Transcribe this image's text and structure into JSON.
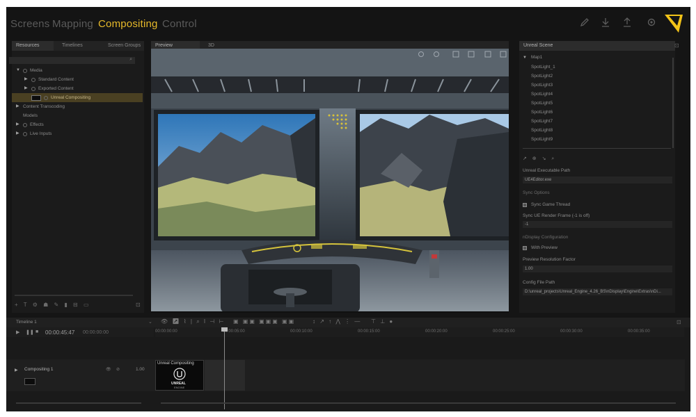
{
  "topbar": {
    "nav": [
      "Screens",
      "Mapping",
      "Compositing",
      "Control"
    ],
    "active_index": 2,
    "accent": "#e6b92a",
    "icons": [
      "edit-icon",
      "download-icon",
      "upload-icon",
      "gear-icon"
    ]
  },
  "resources_panel": {
    "tabs": [
      "Resources",
      "Timelines",
      "Screen Groups"
    ],
    "tree": [
      {
        "label": "Media",
        "level": 0,
        "arrow": "▼",
        "circle": true
      },
      {
        "label": "Standard Content",
        "level": 1,
        "arrow": "▶",
        "circle": true
      },
      {
        "label": "Exported Content",
        "level": 1,
        "arrow": "▶",
        "circle": true
      },
      {
        "label": "Unreal Compositing",
        "level": 1,
        "arrow": "",
        "circle": true,
        "selected": true
      },
      {
        "label": "Content Transcoding",
        "level": 0,
        "arrow": "▶",
        "circle": false
      },
      {
        "label": "Models",
        "level": 0,
        "arrow": "",
        "circle": false
      },
      {
        "label": "Effects",
        "level": 0,
        "arrow": "▶",
        "circle": true
      },
      {
        "label": "Live Inputs",
        "level": 0,
        "arrow": "▶",
        "circle": true
      }
    ]
  },
  "preview_panel": {
    "tabs": [
      "Preview",
      "3D"
    ]
  },
  "unreal_panel": {
    "title": "Unreal Scene",
    "root": "Map1",
    "spotlights": [
      "SpotLight_1",
      "SpotLight2",
      "SpotLight3",
      "SpotLight4",
      "SpotLight5",
      "SpotLight6",
      "SpotLight7",
      "SpotLight8",
      "SpotLight9"
    ],
    "exec_path_label": "Unreal Executable Path",
    "exec_path_value": "UE4Editor.exe",
    "sync_options_label": "Sync Options",
    "sync_game_thread_label": "Sync Game Thread",
    "sync_ue_render_label": "Sync UE Render Frame (-1 is off)",
    "sync_ue_render_value": "-1",
    "ndisplay_label": "nDisplay Configuration",
    "with_preview_label": "With Preview",
    "preview_res_label": "Preview Resolution Factor",
    "preview_res_value": "1.00",
    "config_path_label": "Config File Path",
    "config_path_value": "D:\\unreal_projects\\Unreal_Engine_4.26_BS\\nDisplay\\Engine\\Extras\\nDi..."
  },
  "timeline": {
    "title": "Timeline 1",
    "timecode": "00:00:45:47",
    "timecode2": "00:00:00:00",
    "ticks": [
      "00:00:00:00",
      "00:00:05:00",
      "00:00:10:00",
      "00:00:15:00",
      "00:00:20:00",
      "00:00:25:00",
      "00:00:30:00",
      "00:00:35:00",
      "00:00:40:00"
    ],
    "track_name": "Compositing 1",
    "track_value": "1.00",
    "clip_label": "Unreal Compositing",
    "clip_logo_text": "UNREAL",
    "clip_logo_subtext": "ENGINE"
  }
}
